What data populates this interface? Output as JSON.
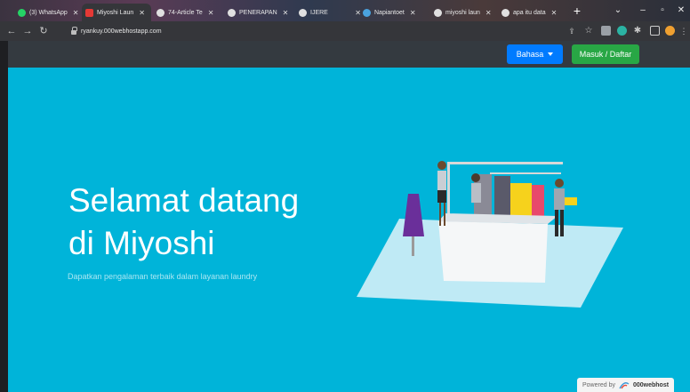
{
  "browser": {
    "tabs": [
      {
        "label": "(3) WhatsApp",
        "fav_color": "#25d366"
      },
      {
        "label": "Miyoshi Laun",
        "fav_color": "#e53935"
      },
      {
        "label": "74-Article Te",
        "fav_color": "#e0e0e0"
      },
      {
        "label": "PENERAPAN",
        "fav_color": "#e0e0e0"
      },
      {
        "label": "IJERE",
        "fav_color": "#e0e0e0"
      },
      {
        "label": "Napiantoet",
        "fav_color": "#4aa3df"
      },
      {
        "label": "miyoshi laun",
        "fav_color": "#e0e0e0"
      },
      {
        "label": "apa itu data",
        "fav_color": "#e0e0e0"
      }
    ],
    "close_glyph": "✕",
    "new_tab": "+",
    "url": "ryankuy.000webhostapp.com"
  },
  "navbar": {
    "language_button": "Bahasa",
    "login_button": "Masuk / Daftar"
  },
  "hero": {
    "title_line1": "Selamat datang",
    "title_line2": "di Miyoshi",
    "subtitle": "Dapatkan pengalaman terbaik dalam layanan laundry"
  },
  "footer": {
    "powered_by": "Powered by",
    "host_name": "000webhost"
  },
  "colors": {
    "hero_bg": "#00b4d9",
    "navbar_bg": "#343a40",
    "primary": "#007bff",
    "success": "#28a745"
  },
  "icons": [
    "back-arrow-icon",
    "forward-arrow-icon",
    "reload-icon",
    "lock-icon",
    "share-icon",
    "star-icon",
    "extension-icon",
    "profile-icon",
    "menu-icon",
    "caret-down-icon",
    "webhost-logo-icon"
  ]
}
